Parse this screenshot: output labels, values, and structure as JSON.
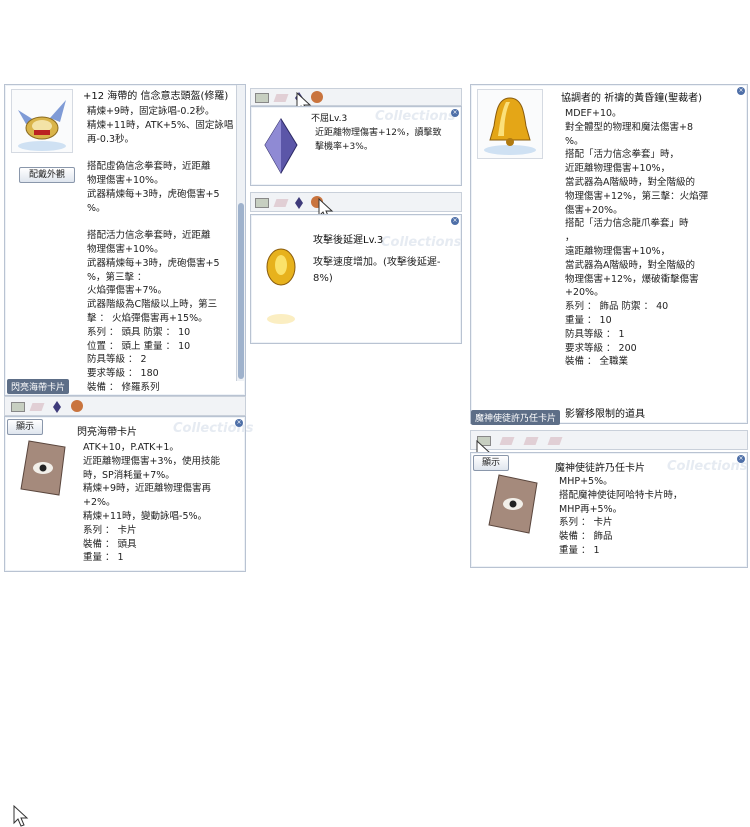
{
  "window1": {
    "title": "+12 海帶的 信念意志頭盔(修羅)",
    "button": "配戴外觀",
    "lines": [
      "精煉+9時，固定詠唱-0.2秒。",
      "精煉+11時，ATK+5%、固定詠唱",
      "再-0.3秒。",
      "",
      "搭配虛偽信念拳套時，近距離",
      "物理傷害+10%。",
      "武器精煉每+3時，虎砲傷害+5",
      "%。",
      "",
      "搭配活力信念拳套時，近距離",
      "物理傷害+10%。",
      "武器精煉每+3時，虎砲傷害+5",
      "%，第三擊 ：",
      "火焰彈傷害+7%。",
      "武器階級為C階級以上時，第三",
      "擊 ： 火焰彈傷害再+15%。",
      "系列 ： 頭具  防禦 ： 10",
      "位置 ： 頭上  重量 ： 10",
      "防具等級 ： 2",
      "要求等級 ： 180",
      "裝備 ： 修羅系列"
    ],
    "card_label": "閃亮海帶卡片"
  },
  "window2": {
    "button": "顯示",
    "title": "閃亮海帶卡片",
    "lines": [
      "ATK+10，P.ATK+1。",
      "近距離物理傷害+3%，使用技能",
      "時，SP消耗量+7%。",
      "精煉+9時，近距離物理傷害再",
      "+2%。",
      "精煉+11時，變動詠唱-5%。",
      "系列 ： 卡片",
      "裝備 ： 頭具",
      "重量 ： 1"
    ],
    "watermark": "Collections"
  },
  "window3": {
    "title": "不屈Lv.3",
    "lines": [
      "近距離物理傷害+12%，讀擊致",
      "擊機率+3%。"
    ],
    "watermark": "Collections"
  },
  "window4": {
    "title": "攻擊後延遲Lv.3",
    "lines": [
      "攻擊速度增加。(攻擊後延遲-",
      "8%)"
    ],
    "watermark": "Collections"
  },
  "window5": {
    "title": "協調者的 祈禱的黃昏鐘(聖裁者)",
    "lines": [
      "MDEF+10。",
      "對全體型的物理和魔法傷害+8",
      "%。",
      "搭配「活力信念拳套」時，",
      "近距離物理傷害+10%，",
      "當武器為A階級時，對全階級的",
      "物理傷害+12%，第三擊：火焰彈",
      "傷害+20%。",
      "搭配「活力信念龍爪拳套」時",
      "，",
      "遠距離物理傷害+10%，",
      "當武器為A階級時，對全階級的",
      "物理傷害+12%，爆破衝擊傷害",
      "+20%。",
      "系列 ： 飾品  防禦 ： 40",
      "重量 ： 10",
      "防具等級 ： 1",
      "要求等級 ： 200",
      "裝備 ： 全職業"
    ],
    "bottom_line": "影響移限制的道具",
    "card_label": "魔神使徒許乃任卡片"
  },
  "window6": {
    "button": "顯示",
    "title": "魔神使徒許乃任卡片",
    "lines": [
      "MHP+5%。",
      "搭配魔神使徒阿哈特卡片時，",
      "MHP再+5%。",
      "系列 ： 卡片",
      "裝備 ： 飾品",
      "重量 ： 1"
    ],
    "watermark": "Collections"
  },
  "colors": {
    "border": "#b9c3d2",
    "label_bg": "#5d6e87",
    "accent": "#4e6fa8"
  }
}
